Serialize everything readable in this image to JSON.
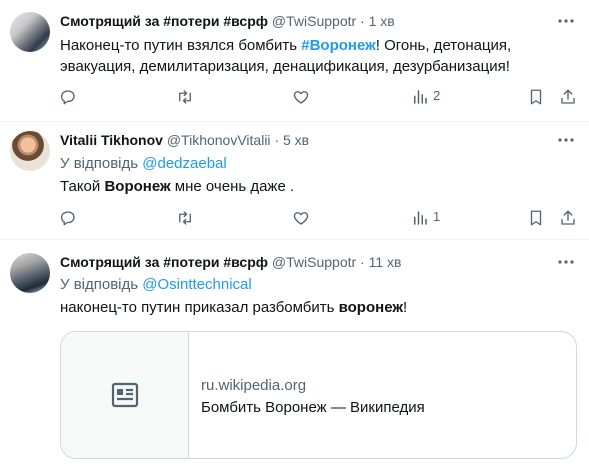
{
  "tweets": [
    {
      "name": "Смотрящий за #потери #всрф",
      "handle": "@TwiSuppotr",
      "sep": "·",
      "time": "1 хв",
      "text": {
        "part1": "Наконец-то путин взялся бомбить ",
        "hashtag": "#Воронеж",
        "part2": "! Огонь, детонация,",
        "line2": "эвакуация, демилитаризация, денацификация, дезурбанизация!"
      },
      "views": "2"
    },
    {
      "name": "Vitalii Tikhonov",
      "handle": "@TikhonovVitalii",
      "sep": "·",
      "time": "5 хв",
      "reply_prefix": "У відповідь ",
      "reply_to": "@dedzaebal",
      "text": {
        "part1": "Такой ",
        "bold": "Воронеж",
        "part2": " мне очень даже ."
      },
      "views": "1"
    },
    {
      "name": "Смотрящий за #потери #всрф",
      "handle": "@TwiSuppotr",
      "sep": "·",
      "time": "11 хв",
      "reply_prefix": "У відповідь ",
      "reply_to": "@Osinttechnical",
      "text": {
        "part1": "наконец-то путин приказал разбомбить ",
        "bold": "воронеж",
        "part2": "!"
      },
      "card": {
        "domain": "ru.wikipedia.org",
        "title": "Бомбить Воронеж — Википедия"
      }
    }
  ],
  "icons": {
    "reply": "reply-icon",
    "retweet": "retweet-icon",
    "like": "heart-icon",
    "views": "views-icon",
    "bookmark": "bookmark-icon",
    "share": "share-icon",
    "more": "more-icon",
    "link_card": "article-icon"
  },
  "colors": {
    "link": "#1d9bf0",
    "text": "#0f1419",
    "secondary": "#536471",
    "border": "#cfd9de"
  }
}
